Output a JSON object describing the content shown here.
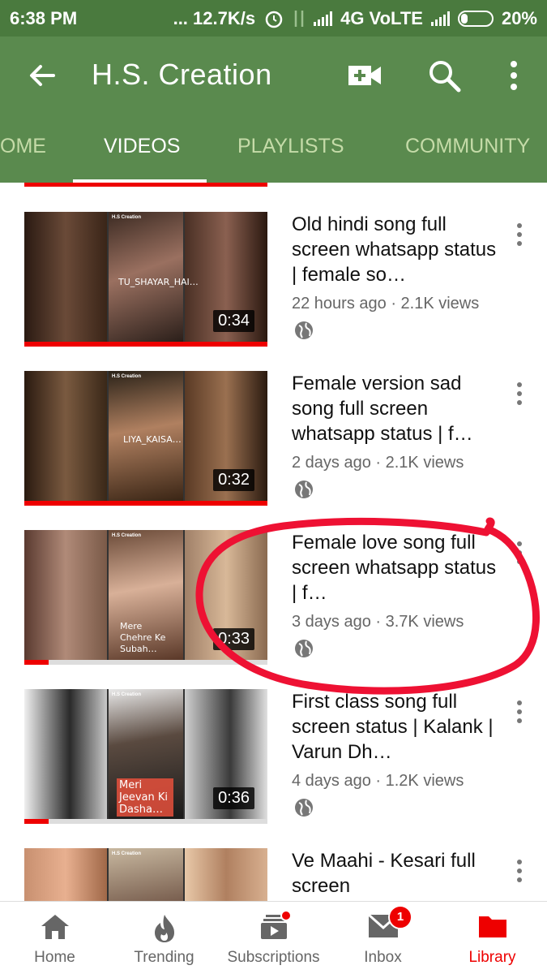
{
  "status_bar": {
    "time": "6:38 PM",
    "speed": "... 12.7K/s",
    "network": "4G VoLTE",
    "battery": "20%"
  },
  "app_bar": {
    "title": "H.S. Creation"
  },
  "tabs": [
    {
      "label": "OME",
      "active": false
    },
    {
      "label": "VIDEOS",
      "active": true
    },
    {
      "label": "PLAYLISTS",
      "active": false
    },
    {
      "label": "COMMUNITY",
      "active": false
    }
  ],
  "videos": [
    {
      "title": "Old hindi song full screen whatsapp status | female so…",
      "meta": "22 hours ago · 2.1K views",
      "duration": "0:34",
      "thumb_caption": "TU_SHAYAR_HAI…",
      "brand": "H.S Creation",
      "watched_fraction": 1.0
    },
    {
      "title": "Female version sad song full screen whatsapp status | f…",
      "meta": "2 days ago · 2.1K views",
      "duration": "0:32",
      "thumb_caption": "LIYA_KAISA…",
      "brand": "H.S Creation",
      "watched_fraction": 1.0
    },
    {
      "title": "Female love song full screen whatsapp status | f…",
      "meta": "3 days ago · 3.7K views",
      "duration": "0:33",
      "thumb_caption": "Mere Chehre Ke Subah…",
      "brand": "H.S Creation",
      "watched_fraction": 0.1
    },
    {
      "title": "First class song full screen status | Kalank | Varun Dh…",
      "meta": "4 days ago · 1.2K views",
      "duration": "0:36",
      "thumb_caption": "Meri Jeevan Ki Dasha…",
      "brand": "H.S Creation",
      "watched_fraction": 0.1
    },
    {
      "title": "Ve Maahi - Kesari full screen",
      "meta": "",
      "duration": "",
      "thumb_caption": "",
      "brand": "H.S Creation",
      "watched_fraction": 0
    }
  ],
  "bottom_nav": [
    {
      "label": "Home",
      "icon": "home-icon",
      "active": false
    },
    {
      "label": "Trending",
      "icon": "trending-icon",
      "active": false
    },
    {
      "label": "Subscriptions",
      "icon": "subscriptions-icon",
      "active": false,
      "dot": true
    },
    {
      "label": "Inbox",
      "icon": "inbox-icon",
      "active": false,
      "badge": "1"
    },
    {
      "label": "Library",
      "icon": "library-icon",
      "active": true
    }
  ],
  "colors": {
    "status_bar": "#4a7a3e",
    "app_bar": "#5a8a4e",
    "accent_red": "#e00000",
    "tab_inactive": "#c5dba8"
  }
}
